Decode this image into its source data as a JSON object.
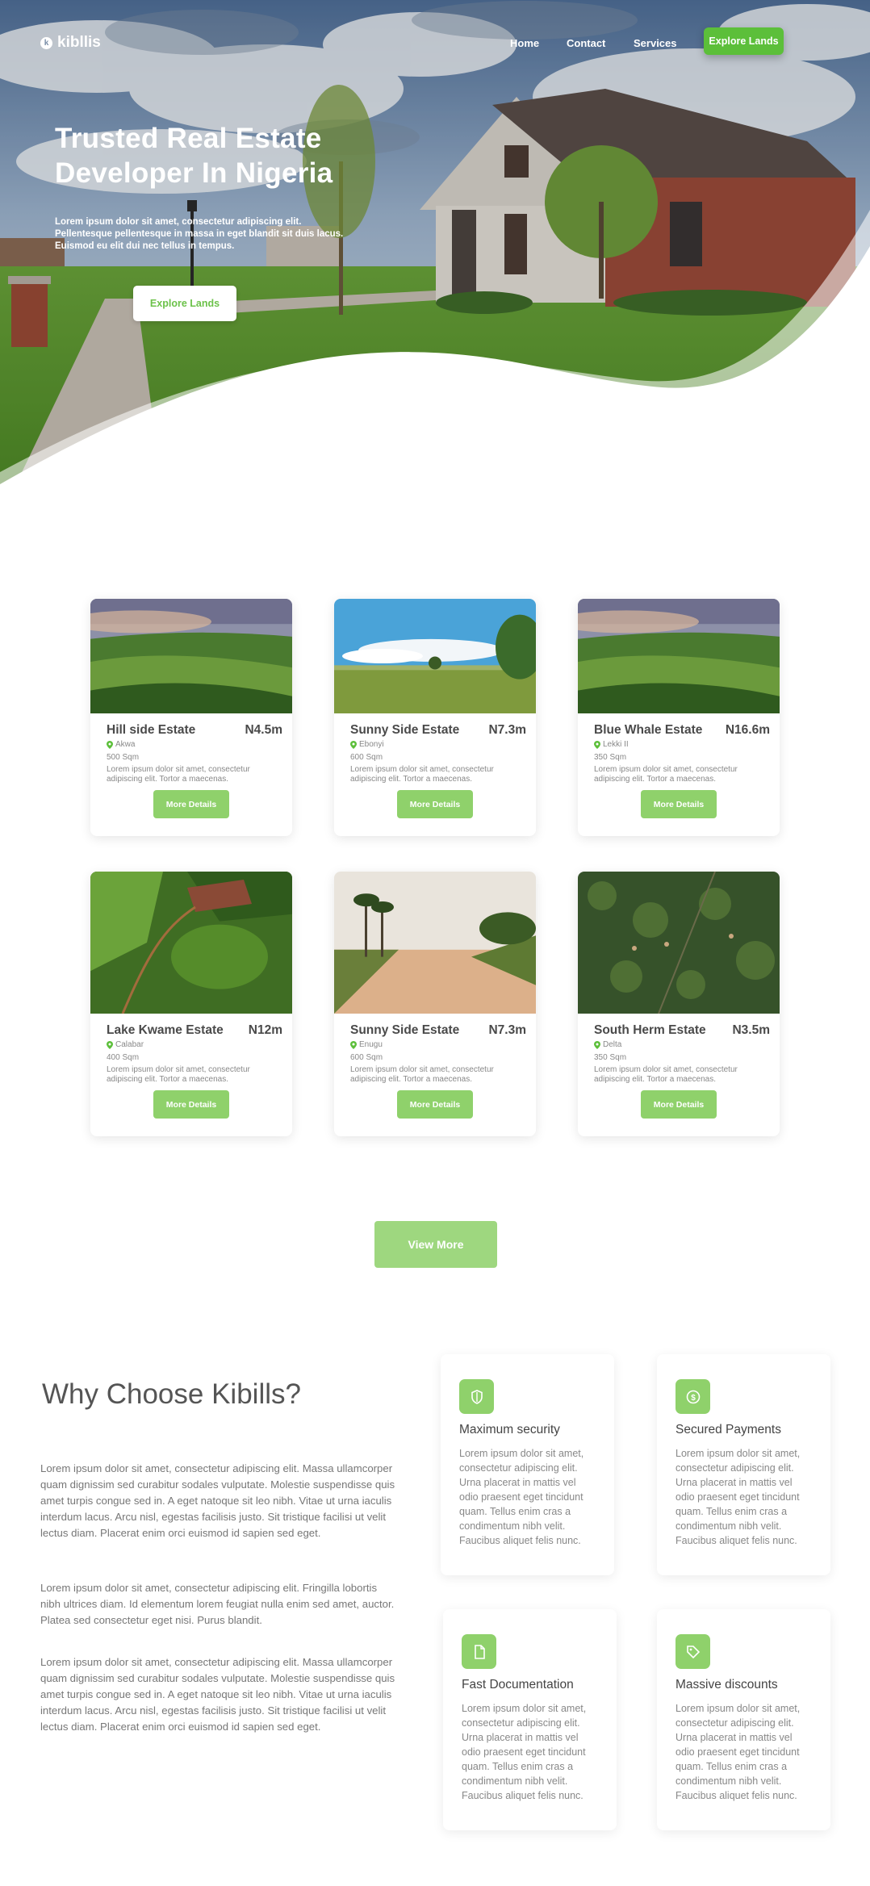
{
  "nav": {
    "logo": "kibllis",
    "logo_mark": "k",
    "links": [
      "Home",
      "Contact",
      "Services"
    ],
    "cta": "Explore Lands"
  },
  "hero": {
    "title": "Trusted Real Estate Developer In Nigeria",
    "subtitle": "Lorem ipsum dolor sit amet, consectetur adipiscing elit. Pellentesque pellentesque in massa in eget blandit sit duis lacus. Euismod eu elit dui nec tellus in tempus.",
    "button": "Explore Lands"
  },
  "listings": [
    {
      "name": "Hill side Estate",
      "price": "N4.5m",
      "location": "Akwa",
      "size": "500 Sqm",
      "description": "Lorem ipsum dolor sit amet, consectetur adipiscing elit. Tortor a maecenas.",
      "button": "More Details",
      "image": "green-hills"
    },
    {
      "name": "Sunny Side Estate",
      "price": "N7.3m",
      "location": "Ebonyi",
      "size": "600 Sqm",
      "description": "Lorem ipsum dolor sit amet, consectetur adipiscing elit. Tortor a maecenas.",
      "button": "More Details",
      "image": "open-field"
    },
    {
      "name": "Blue Whale Estate",
      "price": "N16.6m",
      "location": "Lekki II",
      "size": "350 Sqm",
      "description": "Lorem ipsum dolor sit amet, consectetur adipiscing elit. Tortor a maecenas.",
      "button": "More Details",
      "image": "green-hills"
    },
    {
      "name": "Lake Kwame Estate",
      "price": "N12m",
      "location": "Calabar",
      "size": "400 Sqm",
      "description": "Lorem ipsum dolor sit amet, consectetur adipiscing elit. Tortor a maecenas.",
      "button": "More Details",
      "image": "aerial-farm"
    },
    {
      "name": "Sunny Side Estate",
      "price": "N7.3m",
      "location": "Enugu",
      "size": "600 Sqm",
      "description": "Lorem ipsum dolor sit amet, consectetur adipiscing elit. Tortor a maecenas.",
      "button": "More Details",
      "image": "dirt-road"
    },
    {
      "name": "South Herm Estate",
      "price": "N3.5m",
      "location": "Delta",
      "size": "350 Sqm",
      "description": "Lorem ipsum dolor sit amet, consectetur adipiscing elit. Tortor a maecenas.",
      "button": "More Details",
      "image": "aerial-forest"
    }
  ],
  "view_more": "View More",
  "why": {
    "title": "Why Choose Kibills?",
    "paragraphs": [
      "Lorem ipsum dolor sit amet, consectetur adipiscing elit. Massa ullamcorper quam dignissim sed curabitur sodales vulputate. Molestie suspendisse quis amet turpis congue sed in. A eget natoque sit leo nibh. Vitae ut urna iaculis interdum lacus. Arcu nisl, egestas facilisis justo. Sit tristique facilisi ut velit lectus diam. Placerat enim orci euismod id sapien sed eget.",
      "Lorem ipsum dolor sit amet, consectetur adipiscing elit. Fringilla lobortis nibh ultrices diam. Id elementum lorem feugiat nulla enim sed amet, auctor. Platea sed consectetur eget nisi. Purus blandit.",
      "Lorem ipsum dolor sit amet, consectetur adipiscing elit. Massa ullamcorper quam dignissim sed curabitur sodales vulputate. Molestie suspendisse quis amet turpis congue sed in. A eget natoque sit leo nibh. Vitae ut urna iaculis interdum lacus. Arcu nisl, egestas facilisis justo. Sit tristique facilisi ut velit lectus diam. Placerat enim orci euismod id sapien sed eget."
    ],
    "features": [
      {
        "title": "Maximum security",
        "icon": "shield-icon",
        "description": "Lorem ipsum dolor sit amet, consectetur adipiscing elit. Urna placerat in mattis vel odio praesent eget tincidunt quam. Tellus enim cras a condimentum nibh velit. Faucibus aliquet felis nunc."
      },
      {
        "title": "Secured Payments",
        "icon": "dollar-icon",
        "description": "Lorem ipsum dolor sit amet, consectetur adipiscing elit. Urna placerat in mattis vel odio praesent eget tincidunt quam. Tellus enim cras a condimentum nibh velit. Faucibus aliquet felis nunc."
      },
      {
        "title": "Fast Documentation",
        "icon": "document-icon",
        "description": "Lorem ipsum dolor sit amet, consectetur adipiscing elit. Urna placerat in mattis vel odio praesent eget tincidunt quam. Tellus enim cras a condimentum nibh velit. Faucibus aliquet felis nunc."
      },
      {
        "title": "Massive discounts",
        "icon": "tag-icon",
        "description": "Lorem ipsum dolor sit amet, consectetur adipiscing elit. Urna placerat in mattis vel odio praesent eget tincidunt quam. Tellus enim cras a condimentum nibh velit. Faucibus aliquet felis nunc."
      }
    ]
  },
  "colors": {
    "accent": "#8fd16b",
    "accent_dark": "#5cbf3a",
    "text": "#555555"
  }
}
